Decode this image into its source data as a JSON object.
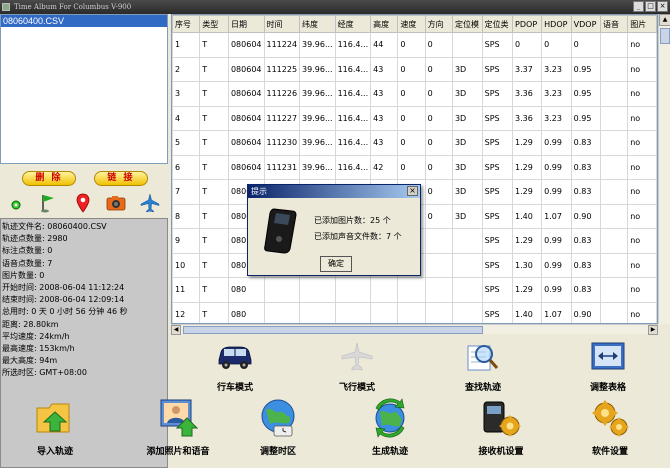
{
  "window": {
    "title": "Time Album For Columbus V-900"
  },
  "file_list": {
    "items": [
      "08060400.CSV"
    ]
  },
  "left_buttons": {
    "delete_label": "删 除",
    "link_label": "链 接"
  },
  "icons": [
    "circle-icon",
    "flag-icon",
    "pin-icon",
    "camera-icon",
    "plane-icon"
  ],
  "info": {
    "lines": [
      "轨迹文件名: 08060400.CSV",
      "轨迹点数量: 2980",
      "标注点数量: 0",
      "语音点数量: 7",
      "图片数量: 0",
      "开始时间: 2008-06-04 11:12:24",
      "结束时间: 2008-06-04 12:09:14",
      "总用时: 0 天 0 小时 56 分钟 46 秒",
      "距离: 28.80km",
      "平均速度: 24km/h",
      "最高速度: 153km/h",
      "最大高度: 94m",
      "所选时区: GMT+08:00"
    ]
  },
  "table": {
    "headers": [
      "序号",
      "类型",
      "日期",
      "时间",
      "纬度",
      "经度",
      "高度",
      "速度",
      "方向",
      "定位模",
      "定位类",
      "PDOP",
      "HDOP",
      "VDOP",
      "语音",
      "图片"
    ],
    "rows": [
      [
        "1",
        "T",
        "080604",
        "111224",
        "39.96...",
        "116.4...",
        "44",
        "0",
        "0",
        "",
        "SPS",
        "0",
        "0",
        "0",
        "",
        "no"
      ],
      [
        "2",
        "T",
        "080604",
        "111225",
        "39.96...",
        "116.4...",
        "43",
        "0",
        "0",
        "3D",
        "SPS",
        "3.37",
        "3.23",
        "0.95",
        "",
        "no"
      ],
      [
        "3",
        "T",
        "080604",
        "111226",
        "39.96...",
        "116.4...",
        "43",
        "0",
        "0",
        "3D",
        "SPS",
        "3.36",
        "3.23",
        "0.95",
        "",
        "no"
      ],
      [
        "4",
        "T",
        "080604",
        "111227",
        "39.96...",
        "116.4...",
        "43",
        "0",
        "0",
        "3D",
        "SPS",
        "3.36",
        "3.23",
        "0.95",
        "",
        "no"
      ],
      [
        "5",
        "T",
        "080604",
        "111230",
        "39.96...",
        "116.4...",
        "43",
        "0",
        "0",
        "3D",
        "SPS",
        "1.29",
        "0.99",
        "0.83",
        "",
        "no"
      ],
      [
        "6",
        "T",
        "080604",
        "111231",
        "39.96...",
        "116.4...",
        "42",
        "0",
        "0",
        "3D",
        "SPS",
        "1.29",
        "0.99",
        "0.83",
        "",
        "no"
      ],
      [
        "7",
        "T",
        "080604",
        "111233",
        "39.96...",
        "116.4...",
        "42",
        "0",
        "0",
        "3D",
        "SPS",
        "1.29",
        "0.99",
        "0.83",
        "",
        "no"
      ],
      [
        "8",
        "T",
        "080604",
        "111234",
        "39.96...",
        "116.4...",
        "41",
        "0",
        "0",
        "3D",
        "SPS",
        "1.40",
        "1.07",
        "0.90",
        "",
        "no"
      ],
      [
        "9",
        "T",
        "080",
        "",
        "",
        "",
        "",
        "",
        "",
        "",
        "SPS",
        "1.29",
        "0.99",
        "0.83",
        "",
        "no"
      ],
      [
        "10",
        "T",
        "080",
        "",
        "",
        "",
        "",
        "",
        "",
        "",
        "SPS",
        "1.30",
        "0.99",
        "0.83",
        "",
        "no"
      ],
      [
        "11",
        "T",
        "080",
        "",
        "",
        "",
        "",
        "",
        "",
        "",
        "SPS",
        "1.29",
        "0.99",
        "0.83",
        "",
        "no"
      ],
      [
        "12",
        "T",
        "080",
        "",
        "",
        "",
        "",
        "",
        "",
        "",
        "SPS",
        "1.40",
        "1.07",
        "0.90",
        "",
        "no"
      ],
      [
        "13",
        "T",
        "080",
        "",
        "",
        "",
        "",
        "",
        "",
        "",
        "SPS",
        "1.29",
        "0.99",
        "0.83",
        "",
        "no"
      ],
      [
        "14",
        "T",
        "080604",
        "111240",
        "39.96...",
        "116.4...",
        "38",
        "0",
        "0",
        "3D",
        "SPS",
        "1.29",
        "0.99",
        "0.83",
        "",
        "no"
      ],
      [
        "15",
        "T",
        "080604",
        "111241",
        "39.96...",
        "116.4...",
        "37",
        "0",
        "0",
        "3D",
        "SPS",
        "1.29",
        "0.99",
        "0.83",
        "",
        "no"
      ]
    ]
  },
  "modes": {
    "drive": "行车模式",
    "fly": "飞行模式",
    "find_track": "查找轨迹",
    "adjust_table": "调整表格"
  },
  "actions": {
    "import": "导入轨迹",
    "add_media": "添加照片和语音",
    "timezone": "调整时区",
    "generate": "生成轨迹",
    "receiver": "接收机设置",
    "software": "软件设置"
  },
  "dialog": {
    "title": "提示",
    "line1": "已添加图片数：25 个",
    "line2": "已添加声音文件数：7 个",
    "ok": "确定"
  }
}
